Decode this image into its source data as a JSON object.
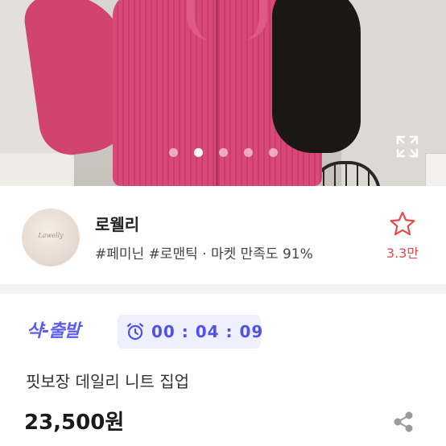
{
  "hero": {
    "carousel": {
      "total": 5,
      "active_index": 1
    },
    "expand_icon": "expand-fullscreen-icon"
  },
  "seller": {
    "avatar_logo_text": "Lawelly",
    "name": "로웰리",
    "tags": "#페미닌 #로맨틱 · 마켓 만족도 91%",
    "follow_icon": "star-outline-icon",
    "follow_count": "3.3만"
  },
  "product": {
    "fast_shipping_label": "샥-출발",
    "timer_icon": "alarm-clock-icon",
    "timer": "00 : 04 : 09",
    "title": "핏보장 데일리 니트 집업",
    "price": "23,500원",
    "share_icon": "share-icon"
  },
  "colors": {
    "accent_blue": "#4f52e8",
    "timer_bg": "#eef0fd",
    "star_red": "#e8494a",
    "knit_pink": "#d8497a"
  }
}
